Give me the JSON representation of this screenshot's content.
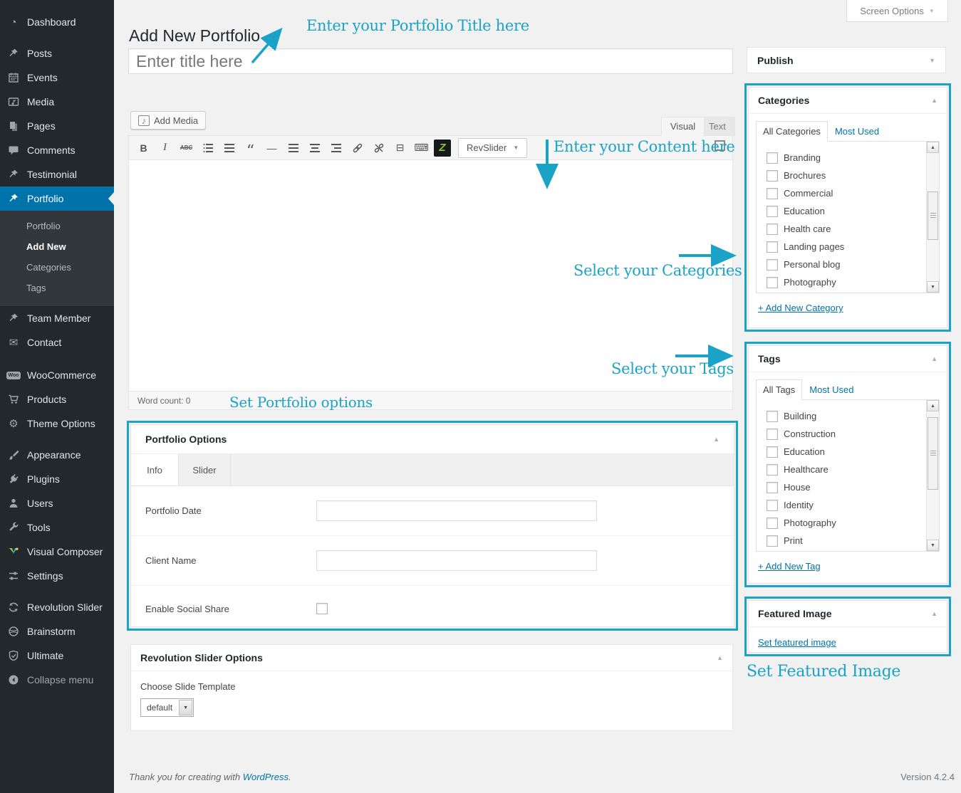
{
  "colors": {
    "accent": "#1aa3c6",
    "menu_bg": "#23282d",
    "menu_active": "#0073aa",
    "link": "#0073aa",
    "page_bg": "#f1f1f1"
  },
  "header": {
    "title": "Add New Portfolio",
    "screen_options": "Screen Options"
  },
  "title_field": {
    "placeholder": "Enter title here"
  },
  "sidebar": {
    "items": [
      "Dashboard",
      "Posts",
      "Events",
      "Media",
      "Pages",
      "Comments",
      "Testimonial",
      "Portfolio",
      "Team Member",
      "Contact",
      "WooCommerce",
      "Products",
      "Theme Options",
      "Appearance",
      "Plugins",
      "Users",
      "Tools",
      "Visual Composer",
      "Settings",
      "Revolution Slider",
      "Brainstorm",
      "Ultimate",
      "Collapse menu"
    ],
    "submenu": [
      "Portfolio",
      "Add New",
      "Categories",
      "Tags"
    ],
    "active_item": "Portfolio",
    "current_submenu": "Add New"
  },
  "editor": {
    "add_media": "Add Media",
    "visual_tab": "Visual",
    "text_tab": "Text",
    "revslider_button": "RevSlider",
    "word_count": "Word count: 0",
    "toolbar_icons": [
      "bold-icon",
      "italic-icon",
      "strikethrough-icon",
      "bullet-list-icon",
      "numbered-list-icon",
      "blockquote-icon",
      "horizontal-rule-icon",
      "align-left-icon",
      "align-center-icon",
      "align-right-icon",
      "link-icon",
      "unlink-icon",
      "more-tag-icon",
      "toolbar-toggle-icon",
      "zilla-shortcode-icon",
      "revslider-dropdown",
      "distraction-free-icon"
    ]
  },
  "annotations": {
    "title": "Enter your Portfolio Title here",
    "content": "Enter your Content here",
    "categories": "Select your Categories",
    "tags": "Select your Tags",
    "portfolio_options": "Set Portfolio options",
    "featured": "Set Featured Image"
  },
  "publish": {
    "title": "Publish"
  },
  "categories": {
    "title": "Categories",
    "tab_all": "All Categories",
    "tab_most": "Most Used",
    "items": [
      "Branding",
      "Brochures",
      "Commercial",
      "Education",
      "Health care",
      "Landing pages",
      "Personal blog",
      "Photography"
    ],
    "add_new": "+ Add New Category"
  },
  "tags": {
    "title": "Tags",
    "tab_all": "All Tags",
    "tab_most": "Most Used",
    "items": [
      "Building",
      "Construction",
      "Education",
      "Healthcare",
      "House",
      "Identity",
      "Photography",
      "Print"
    ],
    "add_new": "+ Add New Tag"
  },
  "featured": {
    "title": "Featured Image",
    "link": "Set featured image"
  },
  "portfolio_options": {
    "title": "Portfolio Options",
    "tabs": [
      "Info",
      "Slider"
    ],
    "fields": [
      "Portfolio Date",
      "Client Name",
      "Enable Social Share"
    ]
  },
  "revslider_options": {
    "title": "Revolution Slider Options",
    "label": "Choose Slide Template",
    "value": "default"
  },
  "footer": {
    "thanks_prefix": "Thank you for creating with",
    "link": "WordPress",
    "thanks_suffix": ".",
    "version": "Version 4.2.4"
  },
  "icons": {
    "chevron_down": "▼",
    "collapse_open": "▲",
    "bold": "B",
    "italic": "I",
    "strike": "ABC",
    "quote": "“",
    "hr": "—",
    "more": "⊟",
    "keyboard": "⌨",
    "zilla": "Z",
    "link": "∞",
    "note": "♪",
    "gear": "⚙",
    "envelope": "✉",
    "dashboard": "◔",
    "select_arrow": "▼",
    "scroll_up": "▲",
    "scroll_down": "▼",
    "woo": "Woo"
  }
}
